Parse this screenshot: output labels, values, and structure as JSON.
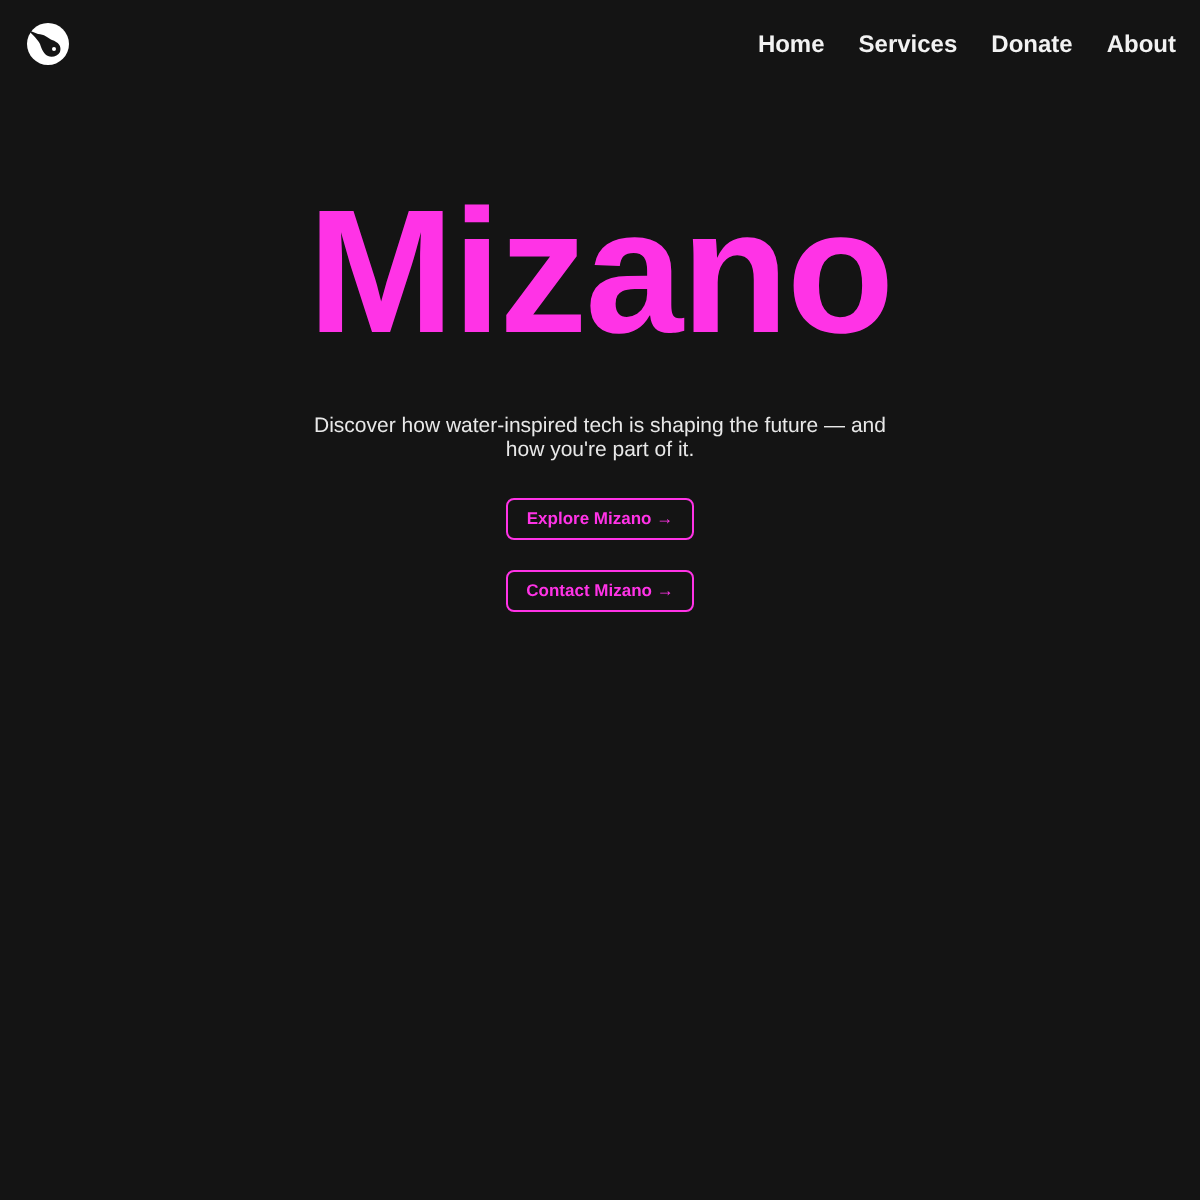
{
  "nav": {
    "links": [
      {
        "label": "Home"
      },
      {
        "label": "Services"
      },
      {
        "label": "Donate"
      },
      {
        "label": "About"
      }
    ]
  },
  "hero": {
    "title": "Mizano",
    "subtitle": "Discover how water-inspired tech is shaping the future — and how you're part of it.",
    "buttons": [
      {
        "label": "Explore Mizano →"
      },
      {
        "label": "Contact Mizano →"
      }
    ]
  }
}
